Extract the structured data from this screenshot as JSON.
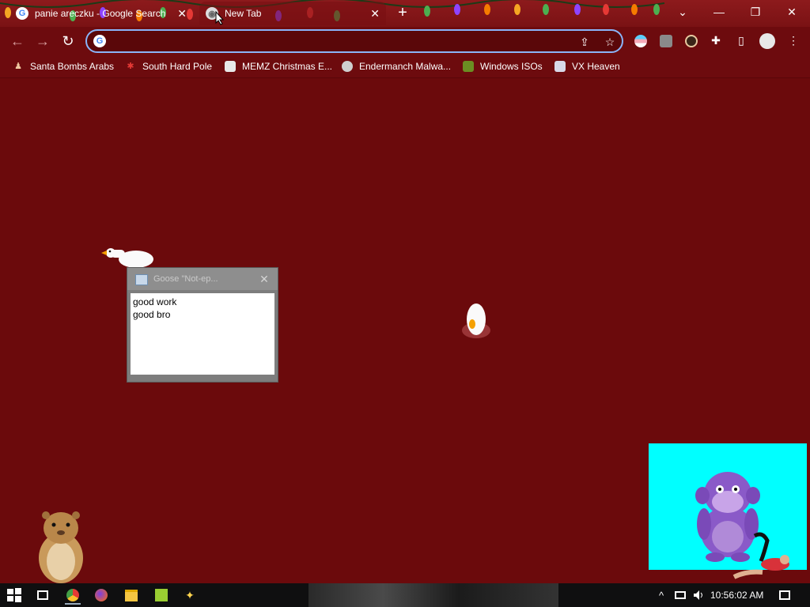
{
  "tabs": [
    {
      "title": "panie areczku - Google Search",
      "favicon": "google-icon",
      "close": "✕"
    },
    {
      "title": "New Tab",
      "favicon": "chrome-icon",
      "close": "✕"
    }
  ],
  "new_tab": "+",
  "window_controls": {
    "tab_search": "⌄",
    "minimize": "—",
    "restore": "❐",
    "close": "✕"
  },
  "toolbar": {
    "back": "←",
    "forward": "→",
    "reload": "↻",
    "address_value": "",
    "share": "⇪",
    "bookmark_star": "☆",
    "extensions": "✚",
    "side_panel": "▯",
    "menu": "⋮"
  },
  "bookmarks": [
    {
      "label": "Santa Bombs Arabs",
      "icon": "santa-icon"
    },
    {
      "label": "South Hard Pole",
      "icon": "snowflake-icon"
    },
    {
      "label": "MEMZ Christmas E...",
      "icon": "memz-icon"
    },
    {
      "label": "Endermanch Malwa...",
      "icon": "raccoon-icon"
    },
    {
      "label": "Windows ISOs",
      "icon": "windows-iso-icon"
    },
    {
      "label": "VX Heaven",
      "icon": "vx-heaven-icon"
    }
  ],
  "dialog": {
    "title": "Goose \"Not-ep...",
    "close": "✕",
    "lines": [
      "good work",
      "good bro"
    ]
  },
  "taskbar": {
    "start": "windows-start-icon",
    "time": "10:56:02 AM",
    "tray_up": "^",
    "network": "network-icon",
    "volume": "volume-icon",
    "notifications": "notification-icon"
  },
  "colors": {
    "page_background": "#6b0a0c",
    "toolbar": "#6d0b0e",
    "omnibox_border": "#8ab4f8",
    "bonzi_background": "#00ffff"
  }
}
